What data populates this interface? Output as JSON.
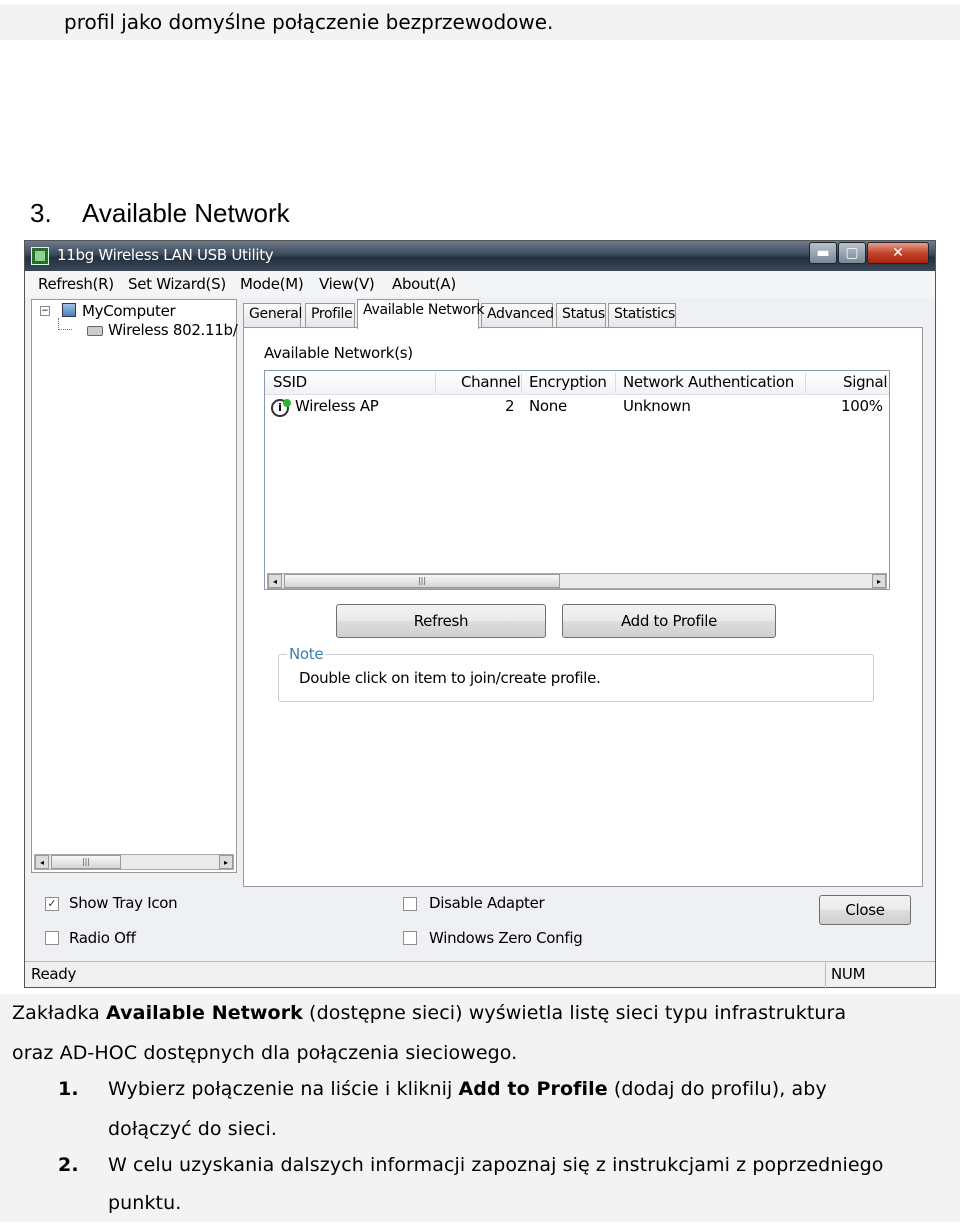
{
  "doc": {
    "top_line": "profil jako domyślne połączenie bezprzewodowe.",
    "heading_number": "3.",
    "heading_text": "Available Network",
    "para1_a": "Zakładka ",
    "para1_b": "Available Network",
    "para1_c": " (dostępne sieci) wyświetla listę sieci typu infrastruktura",
    "para1_d": "oraz AD-HOC dostępnych dla połączenia sieciowego.",
    "step1_num": "1.",
    "step1_a": "Wybierz połączenie na liście i kliknij ",
    "step1_b": "Add to Profile",
    "step1_c": " (dodaj do profilu), aby",
    "step1_d": "dołączyć do sieci.",
    "step2_num": "2.",
    "step2_a": "W celu uzyskania dalszych informacji zapoznaj się z instrukcjami z poprzedniego",
    "step2_b": "punktu."
  },
  "window": {
    "title": "11bg Wireless LAN USB Utility",
    "minimize": "▬",
    "maximize": "▢",
    "close": "✕"
  },
  "menu": [
    "Refresh(R)",
    "Set Wizard(S)",
    "Mode(M)",
    "View(V)",
    "About(A)"
  ],
  "tree": {
    "expander": "−",
    "root": "MyComputer",
    "child": "Wireless 802.11b/"
  },
  "tabs": [
    "General",
    "Profile",
    "Available Network",
    "Advanced",
    "Status",
    "Statistics"
  ],
  "panel": {
    "section_label": "Available Network(s)",
    "columns": [
      "SSID",
      "Channel",
      "Encryption",
      "Network Authentication",
      "Signal"
    ],
    "row": {
      "ssid": "Wireless AP",
      "channel": "2",
      "encryption": "None",
      "auth": "Unknown",
      "signal": "100%"
    },
    "refresh": "Refresh",
    "add_to_profile": "Add to Profile",
    "note_title": "Note",
    "note_text": "Double click on item to join/create profile."
  },
  "bottom": {
    "show_tray_icon": "Show Tray Icon",
    "show_tray_checked": "✓",
    "radio_off": "Radio Off",
    "disable_adapter": "Disable Adapter",
    "windows_zero_config": "Windows Zero Config",
    "close": "Close"
  },
  "status": {
    "left": "Ready",
    "right": "NUM"
  },
  "icons": {
    "scroll_left": "◂",
    "scroll_right": "▸",
    "grip": "|||"
  }
}
